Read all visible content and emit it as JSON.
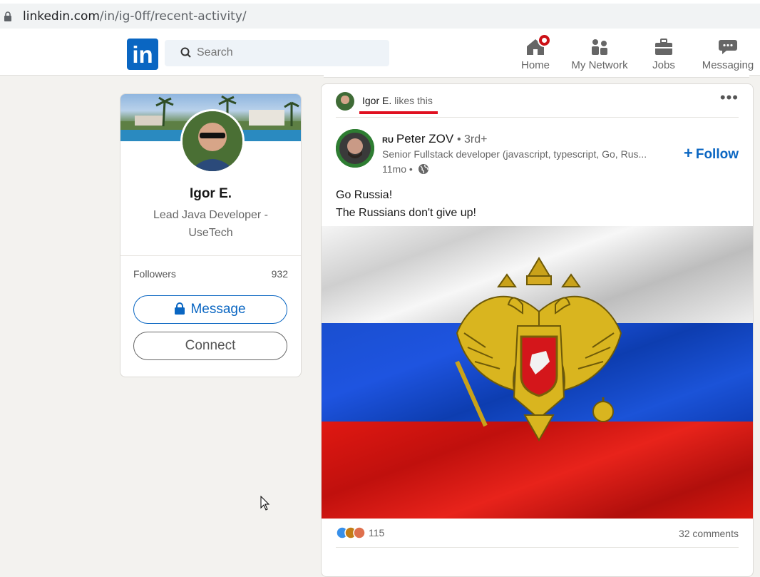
{
  "browser": {
    "url_domain": "linkedin.com",
    "url_path": "/in/ig-0ff/recent-activity/"
  },
  "nav": {
    "logo": "in",
    "search_placeholder": "Search",
    "items": [
      {
        "label": "Home",
        "icon": "home-icon",
        "has_badge": true
      },
      {
        "label": "My Network",
        "icon": "network-icon"
      },
      {
        "label": "Jobs",
        "icon": "briefcase-icon"
      },
      {
        "label": "Messaging",
        "icon": "messaging-icon"
      }
    ]
  },
  "profile": {
    "name": "Igor E.",
    "headline": "Lead Java Developer - UseTech",
    "followers_label": "Followers",
    "followers_count": "932",
    "message_label": "Message",
    "connect_label": "Connect"
  },
  "post": {
    "liker_name": "Igor E.",
    "liker_suffix": "likes this",
    "author_flag": "RU",
    "author_name": "Peter ZOV",
    "author_degree": "• 3rd+",
    "author_headline": "Senior Fullstack developer (javascript, typescript, Go, Rus...",
    "time": "11mo •",
    "follow_label": "Follow",
    "text_line1": "Go Russia!",
    "text_line2": "The Russians don't give up!",
    "reactions_count": "115",
    "comments": "32 comments"
  },
  "colors": {
    "brand": "#0a66c2",
    "highlight_underline": "#e01020",
    "badge": "#cc1016"
  }
}
